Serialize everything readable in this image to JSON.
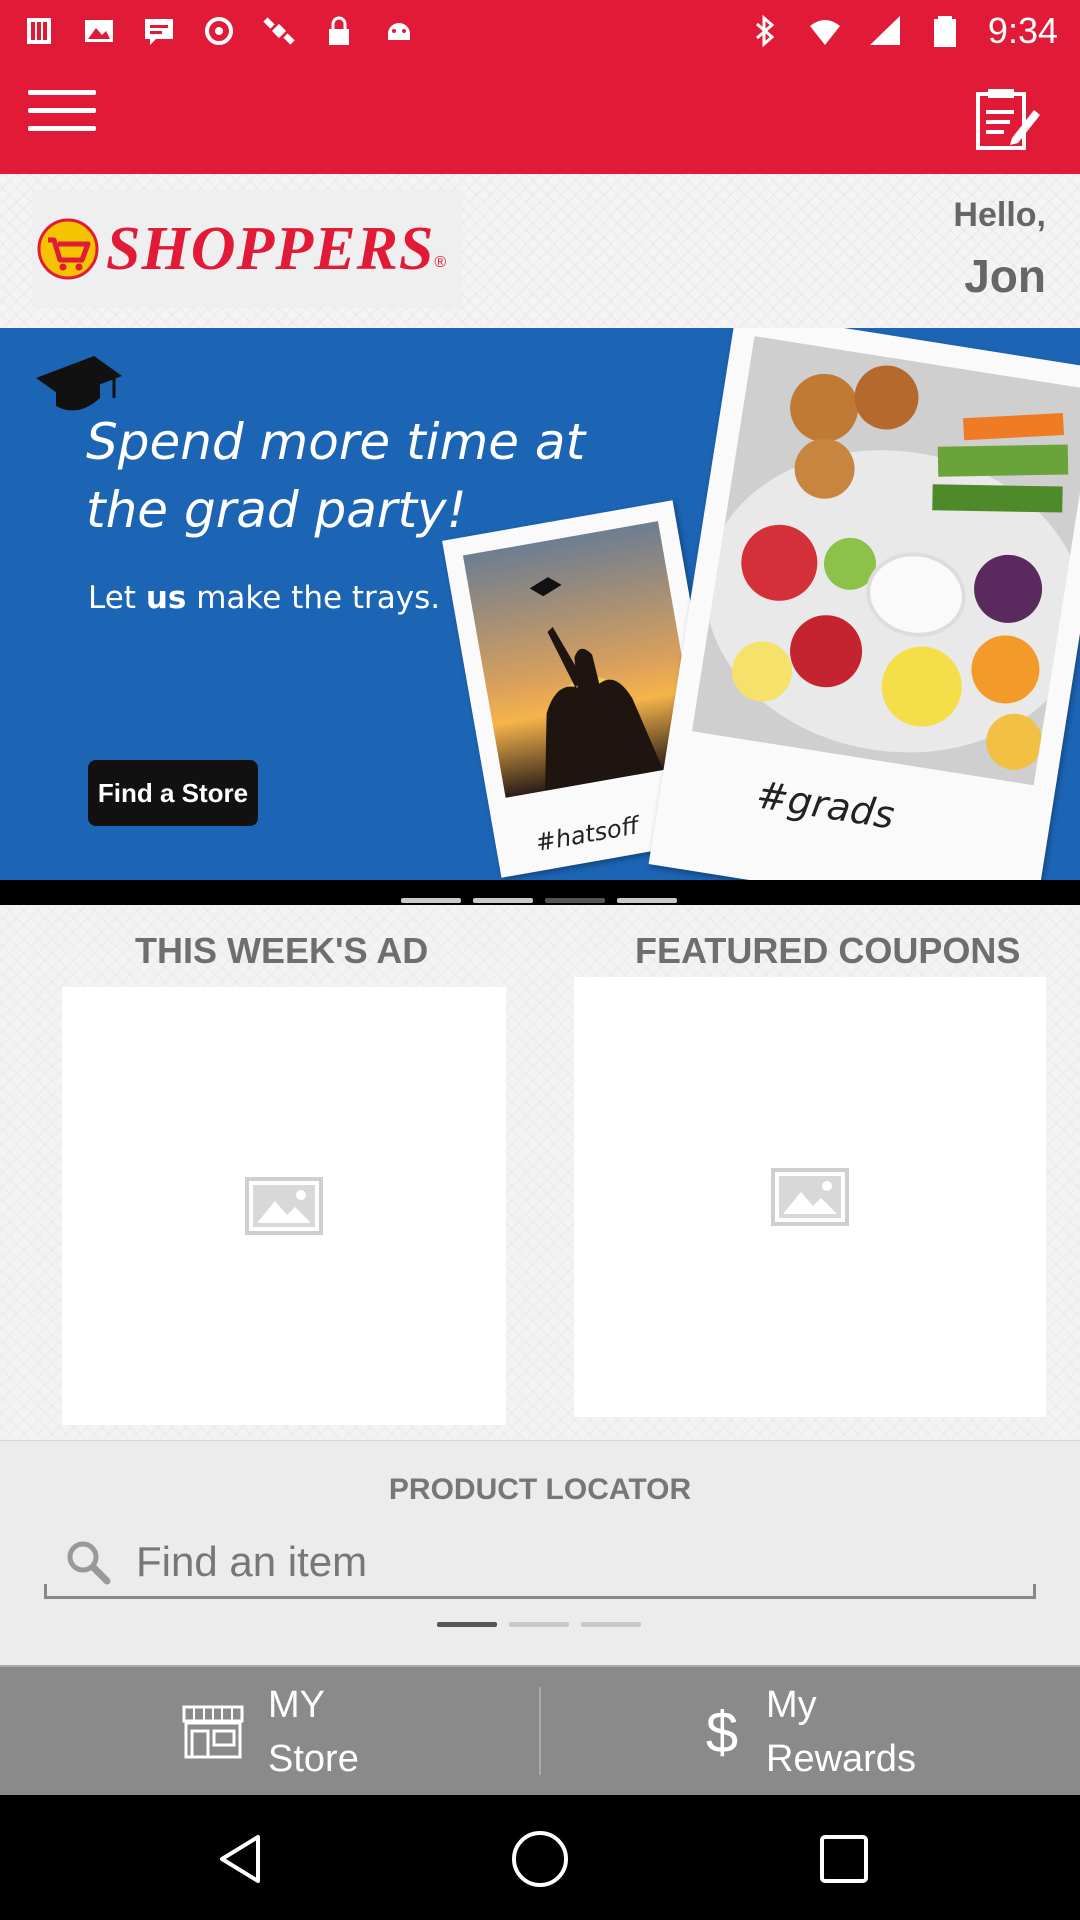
{
  "status_bar": {
    "time": "9:34",
    "left_icons": [
      "notification-icon",
      "image-icon",
      "message-icon",
      "settings-icon",
      "satellite-icon",
      "lock-icon",
      "android-icon"
    ],
    "right_icons": [
      "bluetooth-icon",
      "wifi-icon",
      "signal-icon",
      "battery-icon"
    ]
  },
  "app_bar": {
    "menu_icon": "hamburger-menu-icon",
    "action_icon": "shopping-list-edit-icon",
    "color": "#e11a38"
  },
  "header": {
    "logo_text": "SHOPPERS",
    "logo_reg": "®",
    "greeting": "Hello,",
    "user_name": "Jon"
  },
  "banner": {
    "headline": "Spend more time at the grad party!",
    "sub_prefix": "Let ",
    "sub_bold": "us",
    "sub_suffix": " make the trays.",
    "button_label": "Find a Store",
    "photo1_caption": "#hatsoff",
    "photo2_caption": "#grads",
    "background_color": "#1c64b4"
  },
  "banner_carousel": {
    "count": 4,
    "active_index": 2
  },
  "sections": {
    "weekly_ad_title": "THIS WEEK'S AD",
    "coupons_title": "FEATURED COUPONS"
  },
  "product_locator": {
    "title": "PRODUCT LOCATOR",
    "placeholder": "Find an item",
    "search_icon": "search-icon"
  },
  "locator_carousel": {
    "count": 3,
    "active_index": 0
  },
  "bottom_nav": {
    "store_line1": "MY",
    "store_line2": "Store",
    "store_icon": "store-icon",
    "rewards_line1": "My",
    "rewards_line2": "Rewards",
    "rewards_icon": "dollar-icon"
  },
  "system_nav": [
    "back-icon",
    "home-icon",
    "recents-icon"
  ]
}
